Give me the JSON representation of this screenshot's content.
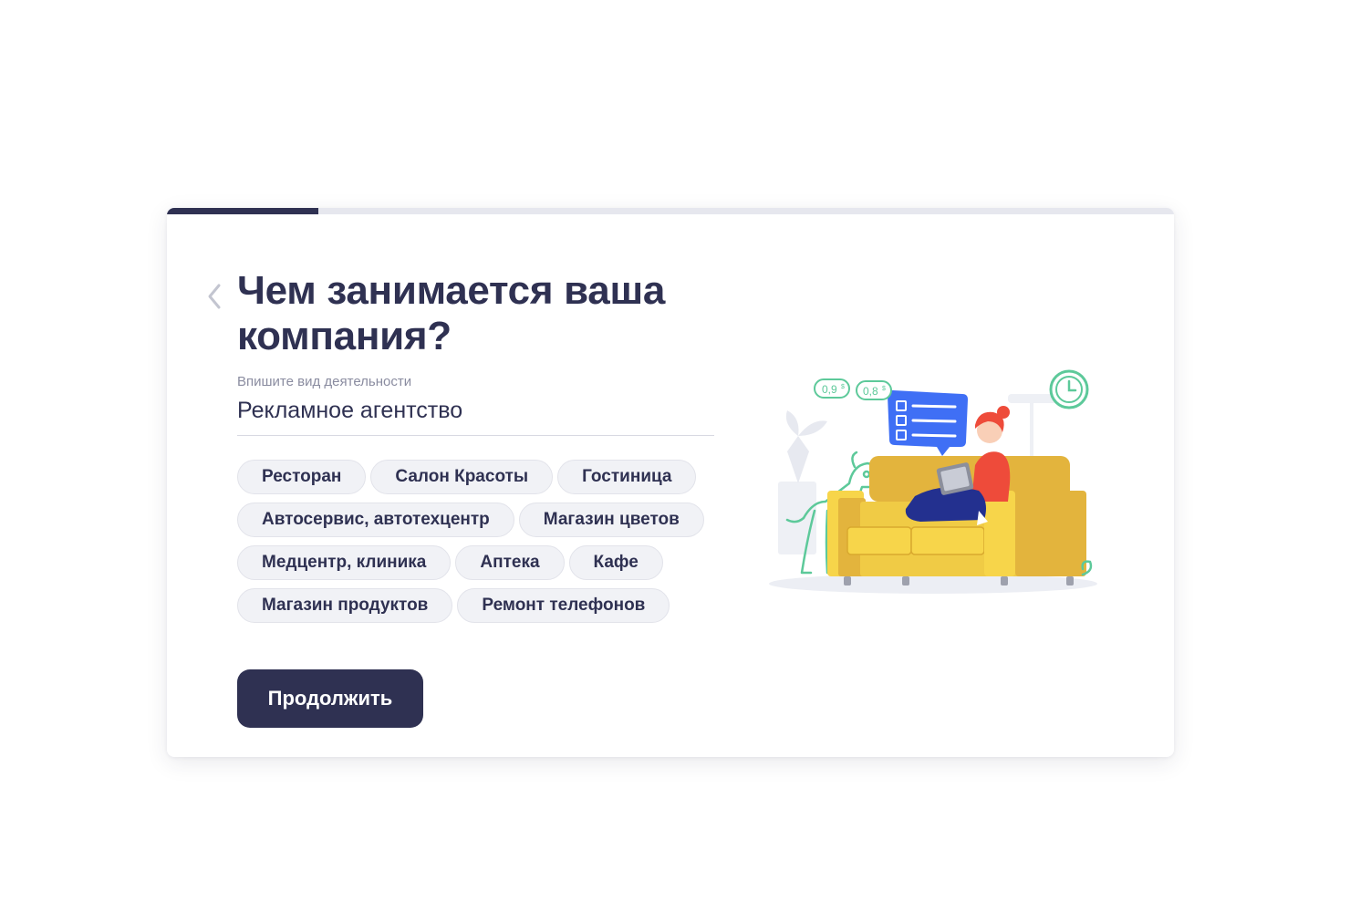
{
  "progress": {
    "fraction": 0.15
  },
  "title": "Чем занимается ваша компания?",
  "field": {
    "label": "Впишите вид деятельности",
    "value": "Рекламное агентство"
  },
  "suggestions": [
    "Ресторан",
    "Салон Красоты",
    "Гостиница",
    "Автосервис, автотехцентр",
    "Магазин цветов",
    "Медцентр, клиника",
    "Аптека",
    "Кафе",
    "Магазин продуктов",
    "Ремонт телефонов"
  ],
  "continue_label": "Продолжить",
  "illustration": {
    "price_tag_1": "0,9",
    "price_tag_2": "0,8",
    "currency": "$"
  },
  "colors": {
    "brand_dark": "#2f3152",
    "progress_track": "#e6e7ee",
    "chip_bg": "#f1f2f6",
    "sofa_yellow": "#f7d54a",
    "accent_green": "#5dc99a",
    "bubble_blue": "#3f6ff5",
    "person_red": "#ee4b3a"
  },
  "icons": {
    "back": "chevron-left-icon",
    "clock": "clock-icon",
    "checklist": "checklist-bubble-icon"
  }
}
